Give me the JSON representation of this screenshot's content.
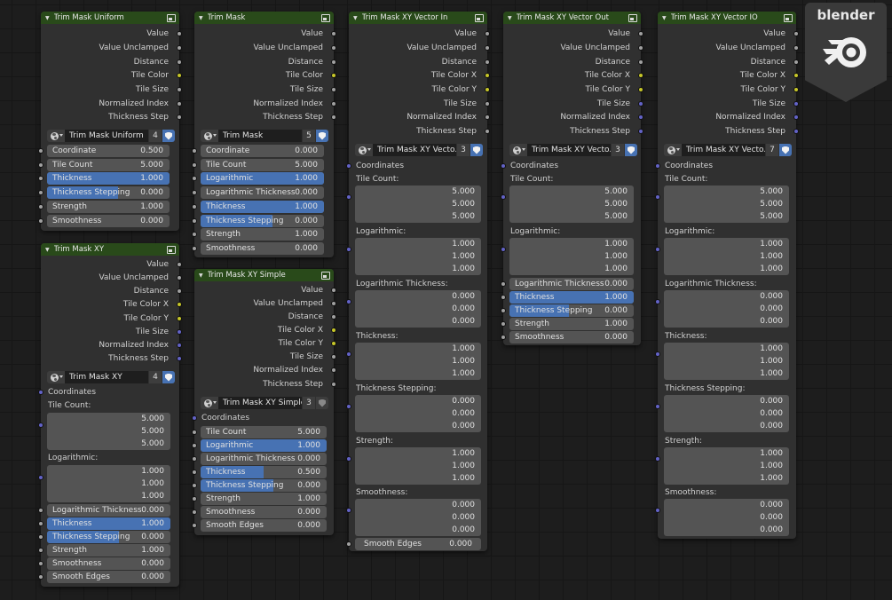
{
  "logo_text": "blender",
  "colors": {
    "accent": "#4772b3",
    "header": "#294a1a",
    "socket_grey": "#a1a1a1",
    "socket_yellow": "#c7c729",
    "socket_purple": "#6363c7"
  },
  "nodes": {
    "uniform": {
      "title": "Trim Mask Uniform",
      "outputs": [
        "Value",
        "Value Unclamped",
        "Distance",
        "Tile Color",
        "Tile Size",
        "Normalized Index",
        "Thickness Step"
      ],
      "group_name": "Trim Mask Uniform",
      "users": "4",
      "inputs": [
        {
          "label": "Coordinate",
          "value": "0.500",
          "fill": 0
        },
        {
          "label": "Tile Count",
          "value": "5.000",
          "fill": 0
        },
        {
          "label": "Thickness",
          "value": "1.000",
          "fill": 1
        },
        {
          "label": "Thickness Stepping",
          "value": "0.000",
          "fill": 0.4
        },
        {
          "label": "Strength",
          "value": "1.000",
          "fill": 0
        },
        {
          "label": "Smoothness",
          "value": "0.000",
          "fill": 0
        }
      ]
    },
    "mask": {
      "title": "Trim Mask",
      "outputs": [
        "Value",
        "Value Unclamped",
        "Distance",
        "Tile Color",
        "Tile Size",
        "Normalized Index",
        "Thickness Step"
      ],
      "group_name": "Trim Mask",
      "users": "5",
      "inputs": [
        {
          "label": "Coordinate",
          "value": "0.000",
          "fill": 0
        },
        {
          "label": "Tile Count",
          "value": "5.000",
          "fill": 0
        },
        {
          "label": "Logarithmic",
          "value": "1.000",
          "fill": 1
        },
        {
          "label": "Logarithmic Thickness",
          "value": "0.000",
          "fill": 0
        },
        {
          "label": "Thickness",
          "value": "1.000",
          "fill": 1
        },
        {
          "label": "Thickness Stepping",
          "value": "0.000",
          "fill": 0.4
        },
        {
          "label": "Strength",
          "value": "1.000",
          "fill": 0
        },
        {
          "label": "Smoothness",
          "value": "0.000",
          "fill": 0
        }
      ]
    },
    "xy": {
      "title": "Trim Mask XY",
      "outputs": [
        "Value",
        "Value Unclamped",
        "Distance",
        "Tile Color X",
        "Tile Color Y",
        "Tile Size",
        "Normalized Index",
        "Thickness Step"
      ],
      "group_name": "Trim Mask XY",
      "users": "4",
      "coordinates": "Coordinates",
      "tile_count_label": "Tile Count:",
      "tile_count": [
        "5.000",
        "5.000",
        "5.000"
      ],
      "logarithmic_label": "Logarithmic:",
      "logarithmic": [
        "1.000",
        "1.000",
        "1.000"
      ],
      "inputs": [
        {
          "label": "Logarithmic Thickness",
          "value": "0.000",
          "fill": 0
        },
        {
          "label": "Thickness",
          "value": "1.000",
          "fill": 1
        },
        {
          "label": "Thickness Stepping",
          "value": "0.000",
          "fill": 0.6
        },
        {
          "label": "Strength",
          "value": "1.000",
          "fill": 0
        },
        {
          "label": "Smoothness",
          "value": "0.000",
          "fill": 0
        },
        {
          "label": "Smooth Edges",
          "value": "0.000",
          "fill": 0
        }
      ]
    },
    "simple": {
      "title": "Trim Mask XY Simple",
      "outputs": [
        "Value",
        "Value Unclamped",
        "Distance",
        "Tile Color X",
        "Tile Color Y",
        "Tile Size",
        "Normalized Index",
        "Thickness Step"
      ],
      "group_name": "Trim Mask XY Simple",
      "users": "3",
      "coordinates": "Coordinates",
      "inputs": [
        {
          "label": "Tile Count",
          "value": "5.000",
          "fill": 0
        },
        {
          "label": "Logarithmic",
          "value": "1.000",
          "fill": 1
        },
        {
          "label": "Logarithmic Thickness",
          "value": "0.000",
          "fill": 0
        },
        {
          "label": "Thickness",
          "value": "0.500",
          "fill": 0.5
        },
        {
          "label": "Thickness Stepping",
          "value": "0.000",
          "fill": 0.6
        },
        {
          "label": "Strength",
          "value": "1.000",
          "fill": 0
        },
        {
          "label": "Smoothness",
          "value": "0.000",
          "fill": 0
        },
        {
          "label": "Smooth Edges",
          "value": "0.000",
          "fill": 0
        }
      ]
    },
    "vin": {
      "title": "Trim Mask XY Vector In",
      "outputs": [
        "Value",
        "Value Unclamped",
        "Distance",
        "Tile Color X",
        "Tile Color Y",
        "Tile Size",
        "Normalized Index",
        "Thickness Step"
      ],
      "group_name": "Trim Mask XY Vecto...",
      "users": "3",
      "coordinates": "Coordinates",
      "vectors": [
        {
          "label": "Tile Count:",
          "values": [
            "5.000",
            "5.000",
            "5.000"
          ]
        },
        {
          "label": "Logarithmic:",
          "values": [
            "1.000",
            "1.000",
            "1.000"
          ]
        },
        {
          "label": "Logarithmic Thickness:",
          "values": [
            "0.000",
            "0.000",
            "0.000"
          ]
        },
        {
          "label": "Thickness:",
          "values": [
            "1.000",
            "1.000",
            "1.000"
          ]
        },
        {
          "label": "Thickness Stepping:",
          "values": [
            "0.000",
            "0.000",
            "0.000"
          ]
        },
        {
          "label": "Strength:",
          "values": [
            "1.000",
            "1.000",
            "1.000"
          ]
        },
        {
          "label": "Smoothness:",
          "values": [
            "0.000",
            "0.000",
            "0.000"
          ]
        }
      ],
      "smooth_edges": {
        "label": "Smooth Edges",
        "value": "0.000"
      }
    },
    "vout": {
      "title": "Trim Mask XY Vector Out",
      "outputs": [
        "Value",
        "Value Unclamped",
        "Distance",
        "Tile Color X",
        "Tile Color Y",
        "Tile Size",
        "Normalized Index",
        "Thickness Step"
      ],
      "group_name": "Trim Mask XY Vecto...",
      "users": "3",
      "coordinates": "Coordinates",
      "vectors": [
        {
          "label": "Tile Count:",
          "values": [
            "5.000",
            "5.000",
            "5.000"
          ]
        },
        {
          "label": "Logarithmic:",
          "values": [
            "1.000",
            "1.000",
            "1.000"
          ]
        }
      ],
      "inputs": [
        {
          "label": "Logarithmic Thickness",
          "value": "0.000",
          "fill": 0
        },
        {
          "label": "Thickness",
          "value": "1.000",
          "fill": 1
        },
        {
          "label": "Thickness Stepping",
          "value": "0.000",
          "fill": 0.6
        },
        {
          "label": "Strength",
          "value": "1.000",
          "fill": 0
        },
        {
          "label": "Smoothness",
          "value": "0.000",
          "fill": 0
        }
      ]
    },
    "vio": {
      "title": "Trim Mask XY Vector IO",
      "outputs": [
        "Value",
        "Value Unclamped",
        "Distance",
        "Tile Color X",
        "Tile Color Y",
        "Tile Size",
        "Normalized Index",
        "Thickness Step"
      ],
      "group_name": "Trim Mask XY Vecto...",
      "users": "7",
      "coordinates": "Coordinates",
      "vectors": [
        {
          "label": "Tile Count:",
          "values": [
            "5.000",
            "5.000",
            "5.000"
          ]
        },
        {
          "label": "Logarithmic:",
          "values": [
            "1.000",
            "1.000",
            "1.000"
          ]
        },
        {
          "label": "Logarithmic Thickness:",
          "values": [
            "0.000",
            "0.000",
            "0.000"
          ]
        },
        {
          "label": "Thickness:",
          "values": [
            "1.000",
            "1.000",
            "1.000"
          ]
        },
        {
          "label": "Thickness Stepping:",
          "values": [
            "0.000",
            "0.000",
            "0.000"
          ]
        },
        {
          "label": "Strength:",
          "values": [
            "1.000",
            "1.000",
            "1.000"
          ]
        },
        {
          "label": "Smoothness:",
          "values": [
            "0.000",
            "0.000",
            "0.000"
          ]
        }
      ]
    }
  }
}
